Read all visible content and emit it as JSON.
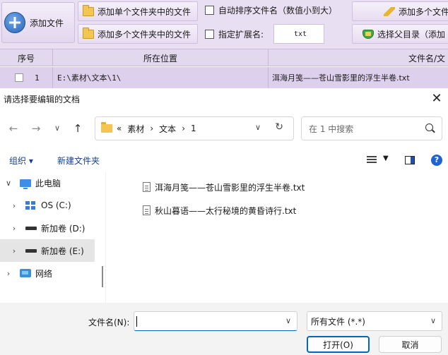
{
  "app": {
    "toolbar": {
      "add_file": "添加文件",
      "add_single_folder": "添加单个文件夹中的文件",
      "add_multi_folder": "添加多个文件夹中的文件",
      "auto_sort": "自动排序文件名（数值小到大）",
      "specify_ext": "指定扩展名:",
      "ext_value": "txt",
      "add_multi_files": "添加多个文件",
      "choose_parent": "选择父目录（添加"
    },
    "table": {
      "headers": [
        "序号",
        "所在位置",
        "文件名/文"
      ],
      "rows": [
        {
          "index": "1",
          "location": "E:\\素材\\文本\\1\\",
          "name": "洱海月笺——苍山雪影里的浮生半卷.txt"
        }
      ]
    }
  },
  "dialog": {
    "title": "请选择要编辑的文档",
    "nav": {
      "back": "←",
      "forward": "→",
      "recent": "∨",
      "up": "↑"
    },
    "breadcrumb": [
      "«",
      "素材",
      "›",
      "文本",
      "›",
      "1"
    ],
    "search_placeholder": "在 1 中搜索",
    "commands": {
      "organize": "组织 ▾",
      "new_folder": "新建文件夹"
    },
    "tree": [
      {
        "label": "此电脑",
        "chevron": "∨",
        "icon": "computer-icon"
      },
      {
        "label": "OS (C:)",
        "chevron": "›",
        "icon": "windows-drive-icon"
      },
      {
        "label": "新加卷 (D:)",
        "chevron": "›",
        "icon": "drive-icon"
      },
      {
        "label": "新加卷 (E:)",
        "chevron": "›",
        "icon": "drive-icon"
      },
      {
        "label": "网络",
        "chevron": "›",
        "icon": "network-icon"
      }
    ],
    "files": [
      {
        "name": "洱海月笺——苍山雪影里的浮生半卷.txt"
      },
      {
        "name": "秋山暮语——太行秘境的黄昏诗行.txt"
      }
    ],
    "filename_label": "文件名(N):",
    "filename_value": "",
    "file_type": "所有文件 (*.*)",
    "open_button": "打开(O)",
    "cancel_button": "取消",
    "accent_color": "#0067c0"
  }
}
